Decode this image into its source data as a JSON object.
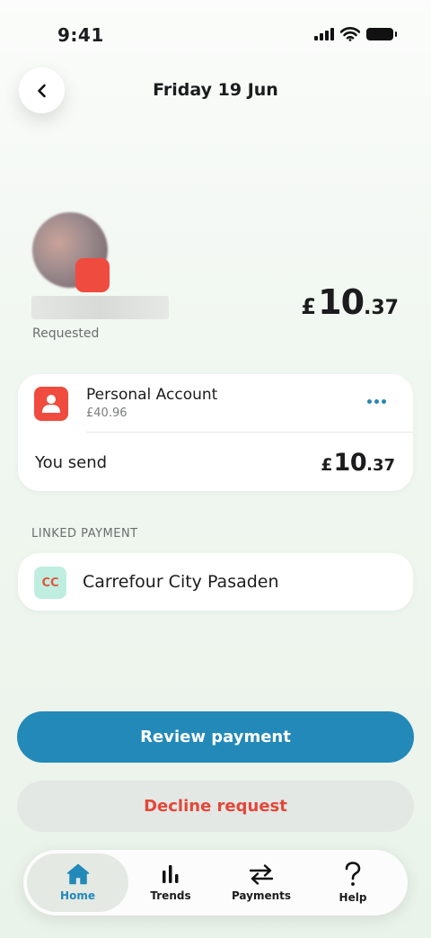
{
  "status_bar": {
    "time": "9:41"
  },
  "header": {
    "title": "Friday 19 Jun"
  },
  "request": {
    "status": "Requested",
    "amount": {
      "currency": "£",
      "whole": "10",
      "decimal": ".37"
    }
  },
  "account": {
    "name": "Personal Account",
    "balance": "£40.96",
    "send_label": "You send",
    "send_amount": {
      "currency": "£",
      "whole": "10",
      "decimal": ".37"
    }
  },
  "linked_payment": {
    "section_label": "LINKED PAYMENT",
    "badge": "CC",
    "merchant": "Carrefour City Pasaden"
  },
  "actions": {
    "review": "Review payment",
    "decline": "Decline request"
  },
  "tabs": [
    {
      "label": "Home",
      "icon": "home-icon",
      "active": true
    },
    {
      "label": "Trends",
      "icon": "bar-chart-icon",
      "active": false
    },
    {
      "label": "Payments",
      "icon": "swap-arrows-icon",
      "active": false
    },
    {
      "label": "Help",
      "icon": "question-icon",
      "active": false
    }
  ],
  "colors": {
    "accent": "#2389b8",
    "danger": "#e2473a",
    "avatar_badge": "#ef4b3f",
    "cc_badge_bg": "#bfeee0"
  }
}
